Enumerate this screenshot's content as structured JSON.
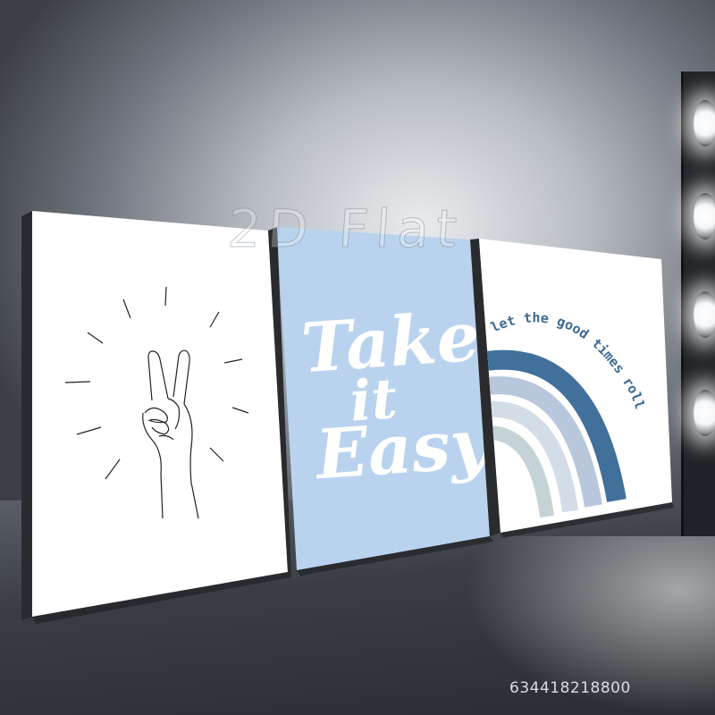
{
  "scene": {
    "watermark_text": "2D Flat",
    "product_id": "634418218800"
  },
  "poster_left": {
    "background": "#ffffff",
    "illustration": "peace-sign-hand-icon"
  },
  "poster_middle": {
    "background": "#b9d3ef",
    "text_color": "#ffffff",
    "line1": "Take",
    "line2": "it",
    "line3": "Easy"
  },
  "poster_right": {
    "background": "#ffffff",
    "arc_text": "let the good times roll",
    "text_color": "#3d6b94",
    "rainbow_colors": [
      "#41709a",
      "#b8c7db",
      "#d3dde8",
      "#c5d3d7"
    ]
  },
  "colors": {
    "frame_edge": "#2a2b2e",
    "floor": "#3a3e44"
  }
}
